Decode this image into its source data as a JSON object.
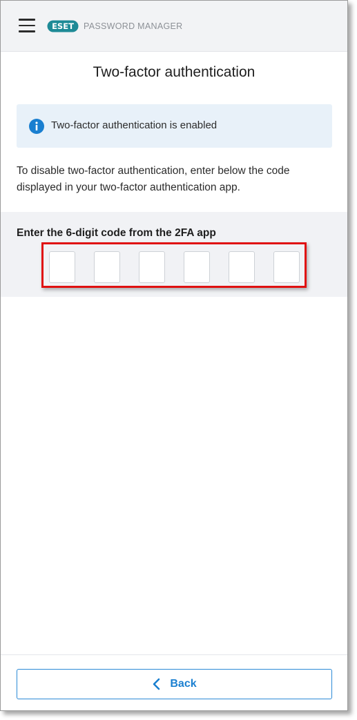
{
  "header": {
    "brand_logo": "ESET",
    "brand_subtitle": "PASSWORD MANAGER",
    "menu_icon": "hamburger-menu-icon"
  },
  "page": {
    "title": "Two-factor authentication"
  },
  "info_banner": {
    "icon": "info-icon",
    "text": "Two-factor authentication is enabled"
  },
  "description": "To disable two-factor authentication, enter below the code displayed in your two-factor authentication app.",
  "code_entry": {
    "label": "Enter the 6-digit code from the 2FA app",
    "digits": [
      "",
      "",
      "",
      "",
      "",
      ""
    ]
  },
  "footer": {
    "back_label": "Back",
    "back_icon": "chevron-left-icon"
  },
  "colors": {
    "accent": "#1a7fd0",
    "info_bg": "#e8f1f9",
    "brand_teal": "#1e8a96",
    "highlight": "#e01010"
  }
}
